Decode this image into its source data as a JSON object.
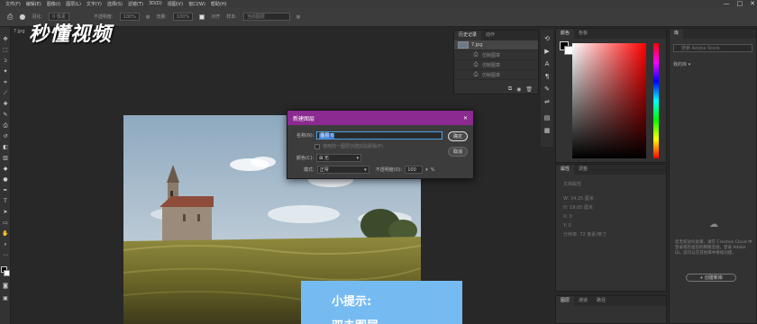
{
  "menu": {
    "items": [
      "文件(F)",
      "编辑(E)",
      "图像(I)",
      "图层(L)",
      "文字(Y)",
      "选择(S)",
      "滤镜(T)",
      "3D(D)",
      "视图(V)",
      "窗口(W)",
      "帮助(H)"
    ],
    "minimize": "—",
    "maximize": "□",
    "close": "✕"
  },
  "options_bar": {
    "feather_label": "羽化:",
    "feather_value": "0 像素",
    "opacity_label": "不透明度:",
    "opacity_value": "100%",
    "flow_label": "流量:",
    "flow_value": "100%",
    "align_label": "对齐",
    "sample_label": "样本:",
    "sample_value": "当前图层"
  },
  "document": {
    "tab": "7.jpg"
  },
  "watermark": "秒懂视频",
  "tip": {
    "title": "小提示:",
    "body": "双击图层"
  },
  "history": {
    "tabs": [
      "历史记录",
      "动作"
    ],
    "items": [
      {
        "label": "7.jpg"
      },
      {
        "label": "仿制图章"
      },
      {
        "label": "仿制图章"
      },
      {
        "label": "仿制图章"
      }
    ]
  },
  "color_panel": {
    "tabs": [
      "颜色",
      "色板"
    ],
    "accent": "#ff0000"
  },
  "properties": {
    "tabs": [
      "属性",
      "调整"
    ],
    "doc_label": "文档属性",
    "w_label": "W: 34.25 厘米",
    "h_label": "H: 19.05 厘米",
    "x_label": "X: 0",
    "y_label": "Y: 0",
    "resolution": "分辨率: 72 像素/英寸"
  },
  "layers": {
    "tabs": [
      "图层",
      "通道",
      "路径"
    ]
  },
  "library": {
    "tab": "库",
    "search_placeholder": "搜索 Adobe Stock",
    "dropdown": "我的库",
    "message": "您无权访问此库。请在 Creative Cloud 中登录或检查您的网络连接。登录 Adobe ID。您可以在其他库中继续创建。",
    "create_button": "+ 创建新库"
  },
  "dialog": {
    "title": "新建图层",
    "close": "✕",
    "name_label": "名称(N):",
    "name_value": "图层 0",
    "clip_label": "使用前一图层创建剪贴蒙版(P)",
    "color_label": "颜色(C):",
    "color_value": "无",
    "mode_label": "模式:",
    "mode_value": "正常",
    "opacity_label": "不透明度(O):",
    "opacity_value": "100",
    "percent": "%",
    "ok": "确定",
    "cancel": "取消"
  }
}
